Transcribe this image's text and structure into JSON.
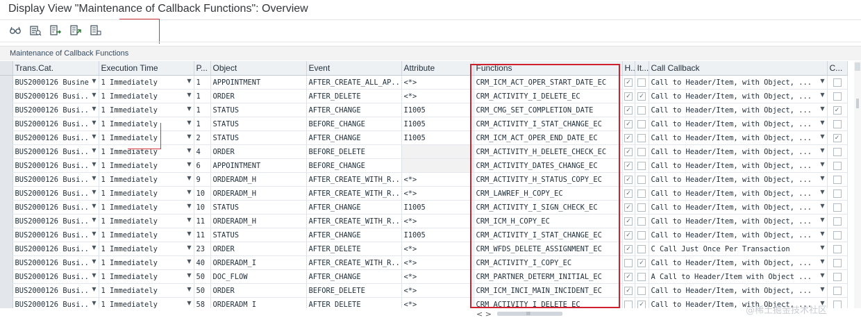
{
  "window": {
    "title": "Display View \"Maintenance of Callback Functions\": Overview"
  },
  "toolbar": {
    "buttons": [
      {
        "icon": "glasses-display-icon"
      },
      {
        "icon": "select-all-icon"
      },
      {
        "icon": "export-icon"
      },
      {
        "icon": "import-icon"
      },
      {
        "icon": "print-icon"
      }
    ]
  },
  "section": {
    "label": "Maintenance of Callback Functions"
  },
  "table": {
    "headers": {
      "trans_cat": "Trans.Cat.",
      "exec_time": "Execution Time",
      "p": "P...",
      "object": "Object",
      "event": "Event",
      "attribute": "Attribute",
      "functions": "Functions",
      "h": "H...",
      "it": "It...",
      "call_callback": "Call Callback",
      "c": "C..."
    },
    "rows": [
      {
        "trans_cat": "BUS2000126 Busine",
        "exec_time": "1 Immediately",
        "p": "1",
        "object": "APPOINTMENT",
        "event": "AFTER_CREATE_ALL_AP...",
        "attribute": "<*>",
        "function": "CRM_ICM_ACT_OPER_START_DATE_EC",
        "h": "✓",
        "it": "",
        "call": "Call to Header/Item, with Object, ...",
        "c": ""
      },
      {
        "trans_cat": "BUS2000126 Busi...",
        "exec_time": "1 Immediately",
        "p": "1",
        "object": "ORDER",
        "event": "AFTER_DELETE",
        "attribute": "<*>",
        "function": "CRM_ACTIVITY_I_DELETE_EC",
        "h": "✓",
        "it": "✓",
        "call": "Call to Header/Item, with Object, ...",
        "c": ""
      },
      {
        "trans_cat": "BUS2000126 Busi...",
        "exec_time": "1 Immediately",
        "p": "1",
        "object": "STATUS",
        "event": "AFTER_CHANGE",
        "attribute": "I1005",
        "function": "CRM_CMG_SET_COMPLETION_DATE",
        "h": "✓",
        "it": "",
        "call": "Call to Header/Item, with Object, ...",
        "c": "✓"
      },
      {
        "trans_cat": "BUS2000126 Busi...",
        "exec_time": "1 Immediately",
        "p": "1",
        "object": "STATUS",
        "event": "BEFORE_CHANGE",
        "attribute": "I1005",
        "function": "CRM_ACTIVITY_I_STAT_CHANGE_EC",
        "h": "✓",
        "it": "",
        "call": "Call to Header/Item, with Object, ...",
        "c": ""
      },
      {
        "trans_cat": "BUS2000126 Busi...",
        "exec_time": "1 Immediately",
        "p": "2",
        "object": "STATUS",
        "event": "AFTER_CHANGE",
        "attribute": "I1005",
        "function": "CRM_ICM_ACT_OPER_END_DATE_EC",
        "h": "✓",
        "it": "",
        "call": "Call to Header/Item, with Object, ...",
        "c": "✓"
      },
      {
        "trans_cat": "BUS2000126 Busi...",
        "exec_time": "1 Immediately",
        "p": "4",
        "object": "ORDER",
        "event": "BEFORE_DELETE",
        "attribute": "",
        "function": "CRM_ACTIVITY_H_DELETE_CHECK_EC",
        "h": "✓",
        "it": "",
        "call": "Call to Header/Item, with Object, ...",
        "c": ""
      },
      {
        "trans_cat": "BUS2000126 Busi...",
        "exec_time": "1 Immediately",
        "p": "6",
        "object": "APPOINTMENT",
        "event": "BEFORE_CHANGE",
        "attribute": "",
        "function": "CRM_ACTIVITY_DATES_CHANGE_EC",
        "h": "✓",
        "it": "",
        "call": "Call to Header/Item, with Object, ...",
        "c": ""
      },
      {
        "trans_cat": "BUS2000126 Busi...",
        "exec_time": "1 Immediately",
        "p": "9",
        "object": "ORDERADM_H",
        "event": "AFTER_CREATE_WITH_R...",
        "attribute": "<*>",
        "function": "CRM_ACTIVITY_H_STATUS_COPY_EC",
        "h": "✓",
        "it": "",
        "call": "Call to Header/Item, with Object, ...",
        "c": ""
      },
      {
        "trans_cat": "BUS2000126 Busi...",
        "exec_time": "1 Immediately",
        "p": "10",
        "object": "ORDERADM_H",
        "event": "AFTER_CREATE_WITH_R...",
        "attribute": "<*>",
        "function": "CRM_LAWREF_H_COPY_EC",
        "h": "✓",
        "it": "",
        "call": "Call to Header/Item, with Object, ...",
        "c": ""
      },
      {
        "trans_cat": "BUS2000126 Busi...",
        "exec_time": "1 Immediately",
        "p": "10",
        "object": "STATUS",
        "event": "AFTER_CHANGE",
        "attribute": "I1005",
        "function": "CRM_ACTIVITY_I_SIGN_CHECK_EC",
        "h": "✓",
        "it": "",
        "call": "Call to Header/Item, with Object, ...",
        "c": ""
      },
      {
        "trans_cat": "BUS2000126 Busi...",
        "exec_time": "1 Immediately",
        "p": "11",
        "object": "ORDERADM_H",
        "event": "AFTER_CREATE_WITH_R...",
        "attribute": "<*>",
        "function": "CRM_ICM_H_COPY_EC",
        "h": "✓",
        "it": "",
        "call": "Call to Header/Item, with Object, ...",
        "c": ""
      },
      {
        "trans_cat": "BUS2000126 Busi...",
        "exec_time": "1 Immediately",
        "p": "11",
        "object": "STATUS",
        "event": "AFTER_CHANGE",
        "attribute": "I1005",
        "function": "CRM_ACTIVITY_I_STAT_CHANGE_EC",
        "h": "✓",
        "it": "",
        "call": "Call to Header/Item, with Object, ...",
        "c": ""
      },
      {
        "trans_cat": "BUS2000126 Busi...",
        "exec_time": "1 Immediately",
        "p": "23",
        "object": "ORDER",
        "event": "AFTER_DELETE",
        "attribute": "<*>",
        "function": "CRM_WFDS_DELETE_ASSIGNMENT_EC",
        "h": "✓",
        "it": "",
        "call": "C Call Just Once Per Transaction",
        "c": ""
      },
      {
        "trans_cat": "BUS2000126 Busi...",
        "exec_time": "1 Immediately",
        "p": "40",
        "object": "ORDERADM_I",
        "event": "AFTER_CREATE_WITH_R...",
        "attribute": "<*>",
        "function": "CRM_ACTIVITY_I_COPY_EC",
        "h": "",
        "it": "✓",
        "call": "Call to Header/Item, with Object, ...",
        "c": ""
      },
      {
        "trans_cat": "BUS2000126 Busi...",
        "exec_time": "1 Immediately",
        "p": "50",
        "object": "DOC_FLOW",
        "event": "AFTER_CHANGE",
        "attribute": "<*>",
        "function": "CRM_PARTNER_DETERM_INITIAL_EC",
        "h": "✓",
        "it": "",
        "call": "A Call to Header/Item with Object ...",
        "c": ""
      },
      {
        "trans_cat": "BUS2000126 Busi...",
        "exec_time": "1 Immediately",
        "p": "50",
        "object": "ORDER",
        "event": "BEFORE_DELETE",
        "attribute": "<*>",
        "function": "CRM_ICM_INCI_MAIN_INCIDENT_EC",
        "h": "✓",
        "it": "",
        "call": "Call to Header/Item, with Object, ...",
        "c": ""
      },
      {
        "trans_cat": "BUS2000126 Busi...",
        "exec_time": "1 Immediately",
        "p": "58",
        "object": "ORDERADM_I",
        "event": "AFTER_DELETE",
        "attribute": "<*>",
        "function": "CRM_ACTIVITY_I_DELETE_EC",
        "h": "",
        "it": "✓",
        "call": "Call to Header/Item, with Object, ...",
        "c": ""
      }
    ]
  },
  "scroll": {
    "h_arrows": "< >",
    "thumb_grip": "III"
  },
  "watermark": "@稀土掘金技术社区",
  "colors": {
    "highlight_border": "#d0202e",
    "header_bg": "#eef1f4",
    "title_text": "#32363a"
  }
}
